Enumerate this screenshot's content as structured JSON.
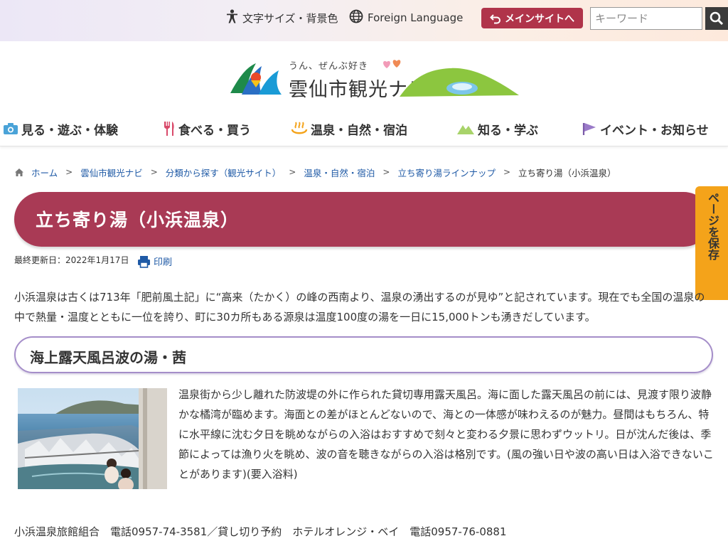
{
  "header": {
    "utility": {
      "text_size": "文字サイズ・背景色",
      "foreign_language": "Foreign Language",
      "main_site": "メインサイトへ"
    },
    "search": {
      "placeholder": "キーワード"
    },
    "logo": {
      "tagline": "うん、ぜんぶ好き",
      "name": "雲仙市観光ナビ"
    }
  },
  "nav": {
    "items": [
      {
        "label": "見る・遊ぶ・体験",
        "icon": "camera-icon"
      },
      {
        "label": "食べる・買う",
        "icon": "fork-knife-icon"
      },
      {
        "label": "温泉・自然・宿泊",
        "icon": "hot-spring-icon"
      },
      {
        "label": "知る・学ぶ",
        "icon": "mountain-icon"
      },
      {
        "label": "イベント・お知らせ",
        "icon": "flag-icon"
      }
    ]
  },
  "breadcrumb": {
    "items": [
      "ホーム",
      "雲仙市観光ナビ",
      "分類から探す（観光サイト）",
      "温泉・自然・宿泊",
      "立ち寄り湯ラインナップ"
    ],
    "current": "立ち寄り湯（小浜温泉）",
    "separator": ">"
  },
  "page": {
    "title": "立ち寄り湯（小浜温泉）",
    "updated": "最終更新日：2022年1月17日",
    "print": "印刷",
    "save_tab": "ページを保存",
    "intro": "小浜温泉は古くは713年「肥前風土記」に“高来（たかく）の峰の西南より、温泉の湧出するのが見ゆ”と記されています。現在でも全国の温泉の中で熱量・温度とともに一位を誇り、町に30カ所もある源泉は温度100度の湯を一日に15,000トンも湧きだしています。",
    "section": {
      "heading": "海上露天風呂波の湯・茜",
      "description": "温泉街から少し離れた防波堤の外に作られた貸切専用露天風呂。海に面した露天風呂の前には、見渡す限り波静かな橘湾が臨めます。海面との差がほとんどないので、海との一体感が味わえるのが魅力。昼間はもちろん、特に水平線に沈む夕日を眺めながらの入浴はおすすめで刻々と変わる夕景に思わずウットリ。日が沈んだ後は、季節によっては漁り火を眺め、波の音を聴きながらの入浴は格別です。(風の強い日や波の高い日は入浴できないことがあります)(要入浴料)",
      "contact": "小浜温泉旅館組合　電話0957-74-3581／貸し切り予約　ホテルオレンジ・ベイ　電話0957-76-0881"
    }
  },
  "colors": {
    "title_band": "#a93a55",
    "main_button": "#b0344a",
    "save_tab": "#f4a31a",
    "link": "#1f5aa6",
    "sub_heading_border": "#a58ec9"
  }
}
